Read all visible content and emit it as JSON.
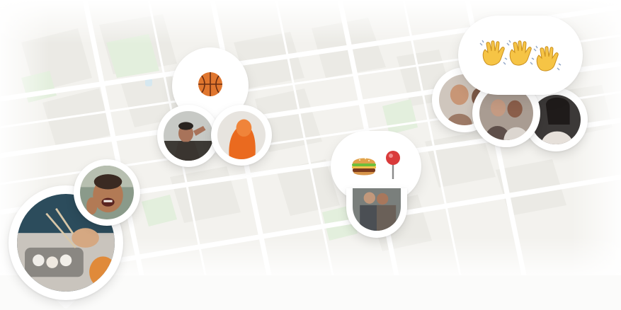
{
  "map": {
    "land_color": "#f1f0ec",
    "block_color": "#eae9e4",
    "park_color": "#dff0db",
    "road_color": "#ffffff",
    "water_color": "#d5e8f2"
  },
  "pins": [
    {
      "id": "pin-large-food",
      "icon": "food-photo-icon"
    },
    {
      "id": "pin-laughing",
      "icon": "person-laughing-photo-icon"
    },
    {
      "id": "pin-man",
      "icon": "person-photo-icon"
    },
    {
      "id": "pin-orange",
      "icon": "person-orange-photo-icon"
    },
    {
      "id": "pin-group",
      "icon": "group-photo-icon"
    },
    {
      "id": "pin-left-right",
      "icon": "people-photo-icon"
    },
    {
      "id": "pin-friends",
      "icon": "friends-photo-icon"
    },
    {
      "id": "pin-dark",
      "icon": "person-dark-photo-icon"
    }
  ],
  "bubbles": {
    "basketball": {
      "emojis": [
        "🏀"
      ],
      "icon": "basketball-icon"
    },
    "burger_pin": {
      "emojis": [
        "🍔",
        "📍"
      ],
      "icons": [
        "burger-icon",
        "round-pushpin-icon"
      ]
    },
    "waving": {
      "emojis": [
        "👋",
        "👋",
        "👋"
      ],
      "icon": "waving-hand-icon"
    }
  },
  "colors": {
    "bubble_bg": "#ffffff",
    "basketball": "#e0762e",
    "burger_bun": "#e2a24a",
    "pin_red": "#d93a3a",
    "hand": "#f6c445"
  }
}
